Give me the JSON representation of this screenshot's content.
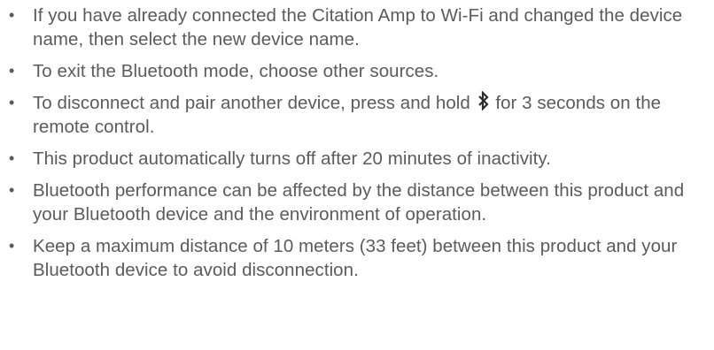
{
  "notes": [
    {
      "text": "If you have already connected the Citation Amp to Wi-Fi and changed the device name, then select the new device name."
    },
    {
      "text_before": "To exit the Bluetooth mode, choose other sources."
    },
    {
      "text_before": "To disconnect and pair another device, press and hold",
      "icon": "bluetooth-icon",
      "text_after": "for 3 seconds on the remote control."
    },
    {
      "text": "This product automatically turns off after 20 minutes of inactivity."
    },
    {
      "text": "Bluetooth performance can be affected by the distance between this product and your Bluetooth device and the environment of operation."
    },
    {
      "text": "Keep a maximum distance of 10 meters (33 feet) between this product and your Bluetooth device to avoid disconnection."
    }
  ],
  "bullet_glyph": "•",
  "colors": {
    "text": "#5b5b5b",
    "icon": "#2b2b2b"
  }
}
